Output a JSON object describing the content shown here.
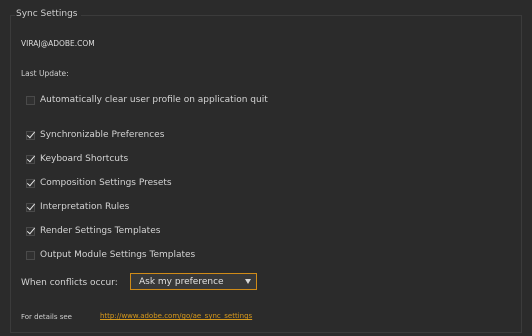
{
  "panel": {
    "title": "Sync Settings"
  },
  "account": {
    "email": "VIRAJ@ADOBE.COM"
  },
  "last_update": {
    "label": "Last Update:"
  },
  "auto_clear": {
    "label": "Automatically clear user profile on application quit",
    "checked": false
  },
  "sync_items": [
    {
      "label": "Synchronizable Preferences",
      "checked": true
    },
    {
      "label": "Keyboard Shortcuts",
      "checked": true
    },
    {
      "label": "Composition Settings Presets",
      "checked": true
    },
    {
      "label": "Interpretation Rules",
      "checked": true
    },
    {
      "label": "Render Settings Templates",
      "checked": true
    },
    {
      "label": "Output Module Settings Templates",
      "checked": false
    }
  ],
  "conflicts": {
    "label": "When conflicts occur:",
    "selected": "Ask my preference"
  },
  "details": {
    "label": "For details see",
    "link": "http://www.adobe.com/go/ae_sync_settings"
  },
  "colors": {
    "background": "#2b2b2b",
    "accent": "#d89a1c"
  }
}
